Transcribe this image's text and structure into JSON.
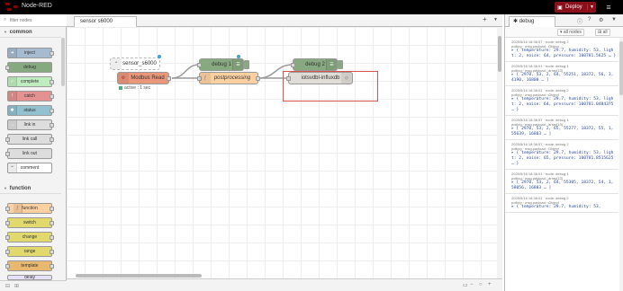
{
  "header": {
    "app_title": "Node-RED",
    "deploy_label": "Deploy"
  },
  "palette": {
    "search_placeholder": "filter nodes",
    "categories": [
      {
        "label": "common",
        "nodes": [
          "inject",
          "debug",
          "complete",
          "catch",
          "status",
          "link in",
          "link call",
          "link out",
          "comment"
        ]
      },
      {
        "label": "function",
        "nodes": [
          "function",
          "switch",
          "change",
          "range",
          "template",
          "delay"
        ]
      }
    ]
  },
  "workspace": {
    "tab_label": "sensor s6000",
    "nodes": {
      "sensor_label": "sensor_s6000",
      "modbus_label": "Modbus Read",
      "modbus_status": "active : 1 sec",
      "debug1_label": "debug 1",
      "postproc_label": "postprocessing",
      "debug2_label": "debug 2",
      "influx_label": "iotsvdbl-influxdb"
    }
  },
  "sidebar": {
    "tab_label": "debug",
    "filter_label": "all nodes",
    "clear_label": "all",
    "messages": [
      {
        "meta": "2025/5/16 18:36:57 · node: debug 2",
        "topic": "polling · msg.payload : Object",
        "body": "▸ { temperature: 29.7, humidity: 53, light: 2, noise: 64, pressure: 100781.5625 … }"
      },
      {
        "meta": "2025/5/16 18:36:01 · node: debug 1",
        "topic": "polling · msg.payload : array[10]",
        "body": "▸ [ 2970, 53, 2, 64, 55251, 18372, 56, 3, 4190, 16800 … ]"
      },
      {
        "meta": "2025/5/16 18:36:01 · node: debug 2",
        "topic": "polling · msg.payload : Object",
        "body": "▸ { temperature: 29.7, humidity: 53, light: 2, noise: 64, pressure: 100781.0484375 … }"
      },
      {
        "meta": "2025/5/16 18:36:57 · node: debug 1",
        "topic": "polling · msg.payload : array[10]",
        "body": "▸ [ 2970, 53, 2, 65, 55277, 18372, 55, 1, 55639, 16803 … ]"
      },
      {
        "meta": "2025/5/16 18:36:57 · node: debug 2",
        "topic": "polling · msg.payload : Object",
        "body": "▸ { temperature: 29.7, humidity: 53, light: 2, noise: 65, pressure: 100781.8515625 … }"
      },
      {
        "meta": "2025/5/16 18:36:01 · node: debug 1",
        "topic": "polling · msg.payload : array[10]",
        "body": "▸ [ 2970, 53, 2, 64, 55305, 18372, 54, 1, 58056, 16803 … ]"
      },
      {
        "meta": "2025/5/16 18:36:01 · node: debug 2",
        "topic": "polling · msg.payload : Object",
        "body": "▸ { temperature: 29.7, humidity: 53,"
      }
    ]
  },
  "colors": {
    "header_bg": "#000000",
    "deploy_bg": "#8c101c",
    "inject": "#a6bbcf",
    "debug": "#87a980",
    "complete": "#c0edc0",
    "catch": "#e49191",
    "status": "#94c1d0",
    "link": "#dddddd",
    "comment": "#ffffff",
    "function": "#fdd0a2",
    "switch": "#e2d96e",
    "modbus": "#e9967a",
    "highlight": "#d9534f"
  }
}
